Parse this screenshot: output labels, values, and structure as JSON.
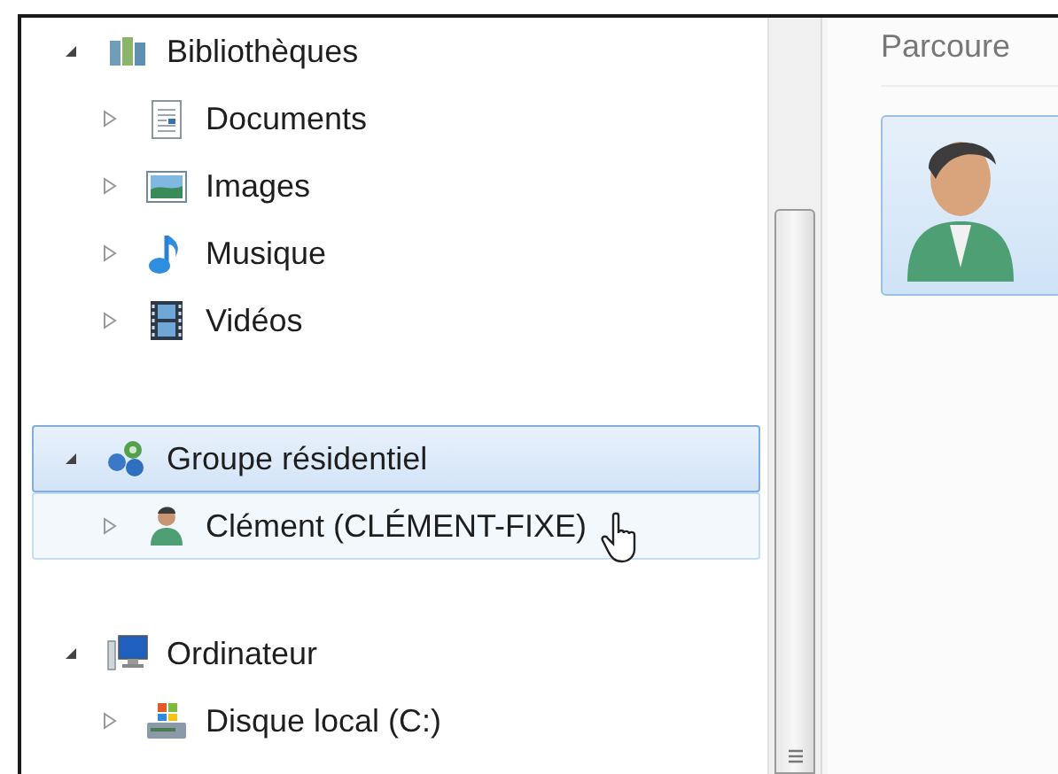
{
  "navigation_pane": {
    "tree": [
      {
        "label": "Bibliothèques",
        "kind": "libraries",
        "expanded": true,
        "selected": false,
        "hovered": false,
        "children": [
          {
            "label": "Documents",
            "kind": "documents",
            "expanded": false,
            "selected": false,
            "hovered": false
          },
          {
            "label": "Images",
            "kind": "images",
            "expanded": false,
            "selected": false,
            "hovered": false
          },
          {
            "label": "Musique",
            "kind": "music",
            "expanded": false,
            "selected": false,
            "hovered": false
          },
          {
            "label": "Vidéos",
            "kind": "videos",
            "expanded": false,
            "selected": false,
            "hovered": false
          }
        ]
      },
      {
        "label": "Groupe résidentiel",
        "kind": "homegroup",
        "expanded": true,
        "selected": true,
        "hovered": false,
        "children": [
          {
            "label": "Clément (CLÉMENT-FIXE)",
            "kind": "user",
            "expanded": false,
            "selected": false,
            "hovered": true
          }
        ]
      },
      {
        "label": "Ordinateur",
        "kind": "computer",
        "expanded": true,
        "selected": false,
        "hovered": false,
        "children": [
          {
            "label": "Disque local (C:)",
            "kind": "drive",
            "expanded": false,
            "selected": false,
            "hovered": false
          }
        ]
      }
    ]
  },
  "content_pane": {
    "heading": "Parcoure"
  }
}
